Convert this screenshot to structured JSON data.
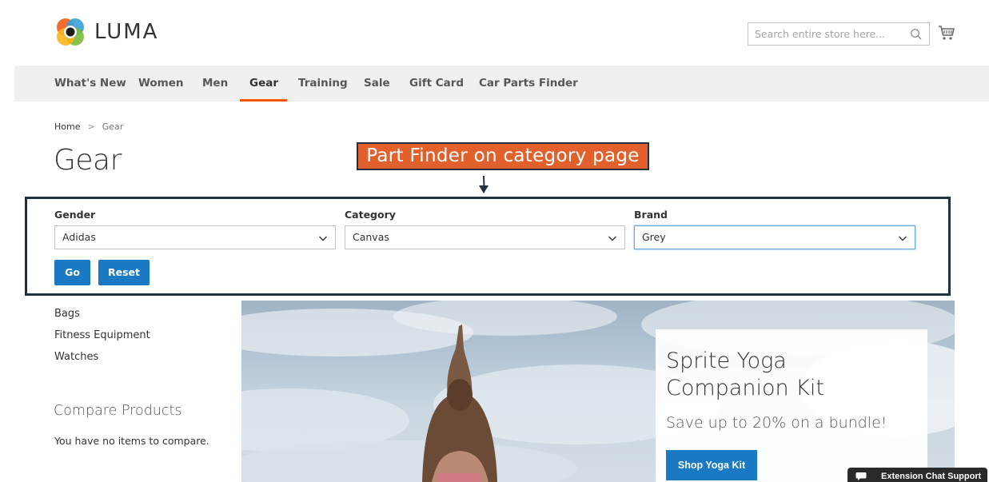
{
  "header": {
    "logo_text": "LUMA",
    "search_placeholder": "Search entire store here...",
    "search_icon": "search-icon",
    "cart_icon": "cart-icon"
  },
  "nav": {
    "items": [
      {
        "label": "What's New"
      },
      {
        "label": "Women"
      },
      {
        "label": "Men"
      },
      {
        "label": "Gear",
        "active": true
      },
      {
        "label": "Training"
      },
      {
        "label": "Sale"
      },
      {
        "label": "Gift Card"
      },
      {
        "label": "Car Parts Finder"
      }
    ],
    "active_color": "#ff5501"
  },
  "breadcrumb": {
    "home": "Home",
    "separator": ">",
    "current": "Gear"
  },
  "page_title": "Gear",
  "annotation": {
    "text": "Part Finder on category page",
    "bg_color": "#e2602c",
    "border_color": "#22313f"
  },
  "finder": {
    "fields": [
      {
        "label": "Gender",
        "value": "Adidas"
      },
      {
        "label": "Category",
        "value": "Canvas"
      },
      {
        "label": "Brand",
        "value": "Grey"
      }
    ],
    "go_label": "Go",
    "reset_label": "Reset",
    "button_color": "#1979c3"
  },
  "sidebar": {
    "categories": [
      "Bags",
      "Fitness Equipment",
      "Watches"
    ],
    "compare_title": "Compare Products",
    "compare_empty": "You have no items to compare."
  },
  "banner": {
    "title": "Sprite Yoga Companion Kit",
    "subtitle": "Save up to 20% on a bundle!",
    "button_label": "Shop Yoga Kit"
  },
  "chat": {
    "label": "Extension Chat Support",
    "icon": "chat-bubble-icon"
  }
}
